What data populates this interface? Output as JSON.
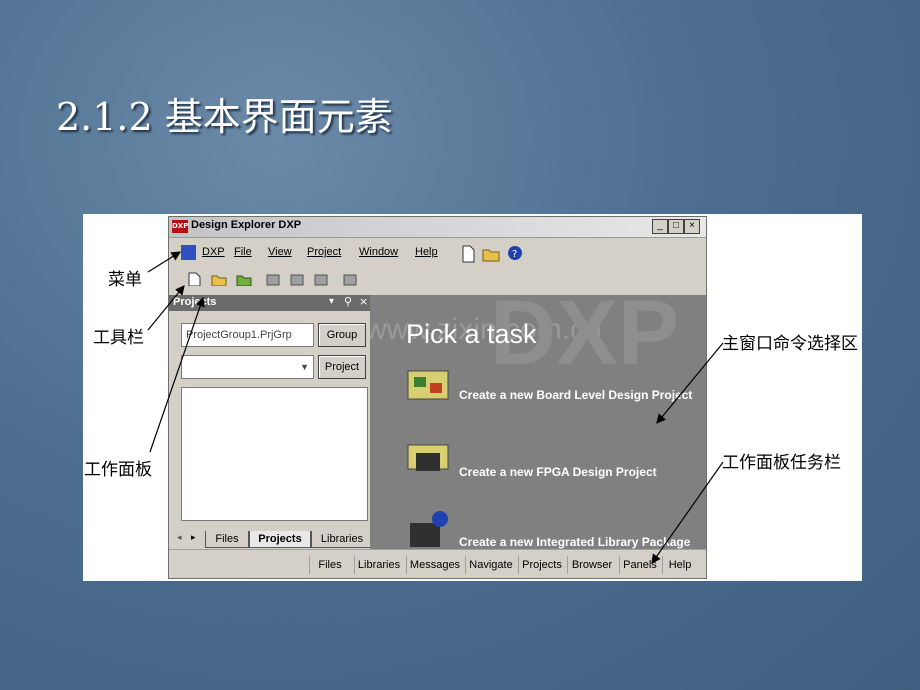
{
  "slide": {
    "title": "2.1.2 基本界面元素"
  },
  "annotations": {
    "menu": "菜单",
    "toolbar": "工具栏",
    "workpanel": "工作面板",
    "main_area": "主窗口命令选择区",
    "panel_taskbar": "工作面板任务栏"
  },
  "app": {
    "window_title": "Design Explorer DXP",
    "icon_text": "DXP",
    "window_buttons": [
      "_",
      "□",
      "×"
    ],
    "menu": [
      "DXP",
      "File",
      "View",
      "Project",
      "Window",
      "Help"
    ],
    "toolbar_icons": [
      "new-document-icon",
      "open-folder-icon",
      "help-icon"
    ],
    "tool_icons": [
      "new-icon",
      "open-icon",
      "open-project-icon",
      "tool-a-icon",
      "tool-b-icon",
      "tool-c-icon",
      "tool-d-icon"
    ],
    "panel": {
      "title": "Projects",
      "project_group_value": "ProjectGroup1.PrjGrp",
      "group_button": "Group",
      "project_button": "Project",
      "tabs": [
        "Files",
        "Projects",
        "Libraries"
      ]
    },
    "main": {
      "heading": "Pick a task",
      "watermark": "www.zixin.com.cn",
      "tasks": [
        "Create a new Board Level Design Project",
        "Create a new FPGA Design Project",
        "Create a new Integrated Library Package"
      ]
    },
    "statusbar": [
      "Files",
      "Libraries",
      "Messages",
      "Navigate",
      "Projects",
      "Browser",
      "Panels",
      "Help"
    ]
  }
}
